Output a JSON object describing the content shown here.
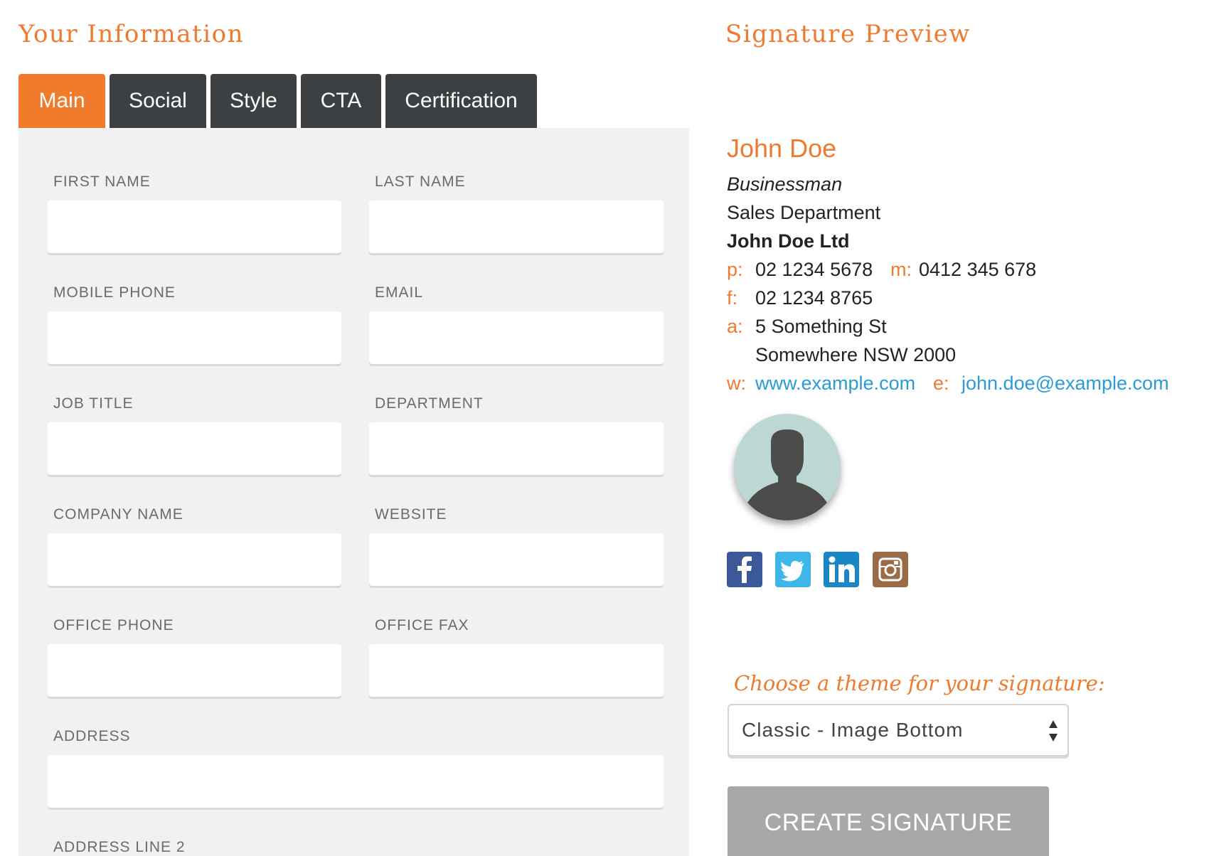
{
  "left_panel": {
    "heading": "Your Information",
    "tabs": [
      {
        "label": "Main",
        "active": true
      },
      {
        "label": "Social",
        "active": false
      },
      {
        "label": "Style",
        "active": false
      },
      {
        "label": "CTA",
        "active": false
      },
      {
        "label": "Certification",
        "active": false
      }
    ],
    "fields": {
      "first_name": {
        "label": "FIRST NAME",
        "value": ""
      },
      "last_name": {
        "label": "LAST NAME",
        "value": ""
      },
      "mobile_phone": {
        "label": "MOBILE PHONE",
        "value": ""
      },
      "email": {
        "label": "EMAIL",
        "value": ""
      },
      "job_title": {
        "label": "JOB TITLE",
        "value": ""
      },
      "department": {
        "label": "DEPARTMENT",
        "value": ""
      },
      "company_name": {
        "label": "COMPANY NAME",
        "value": ""
      },
      "website": {
        "label": "WEBSITE",
        "value": ""
      },
      "office_phone": {
        "label": "OFFICE PHONE",
        "value": ""
      },
      "office_fax": {
        "label": "OFFICE FAX",
        "value": ""
      },
      "address": {
        "label": "ADDRESS",
        "value": ""
      },
      "address_line_2": {
        "label": "ADDRESS LINE 2"
      }
    }
  },
  "preview": {
    "heading": "Signature Preview",
    "name": "John Doe",
    "title": "Businessman",
    "department": "Sales Department",
    "company": "John Doe Ltd",
    "phone_key": "p:",
    "phone": "02 1234 5678",
    "mobile_key": "m:",
    "mobile": "0412 345 678",
    "fax_key": "f:",
    "fax": "02 1234 8765",
    "address_key": "a:",
    "address_line1": "5 Something St",
    "address_line2": "Somewhere NSW 2000",
    "web_key": "w:",
    "website": "www.example.com",
    "email_key": "e:",
    "email": "john.doe@example.com",
    "social_icons": [
      "facebook-icon",
      "twitter-icon",
      "linkedin-icon",
      "instagram-icon"
    ]
  },
  "theme": {
    "label": "Choose a theme for your signature:",
    "selected": "Classic - Image Bottom"
  },
  "actions": {
    "create_label": "CREATE SIGNATURE"
  },
  "colors": {
    "accent": "#ef7a2e",
    "tab_dark": "#3d4042",
    "link": "#2a9bd6",
    "button_disabled": "#a8a8a8"
  }
}
